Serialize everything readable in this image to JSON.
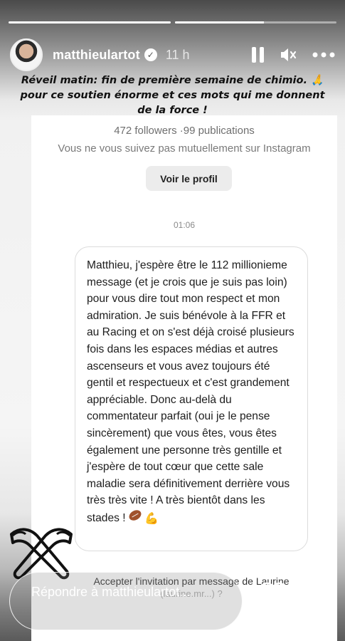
{
  "story": {
    "progress": [
      1.0,
      0.55
    ],
    "username": "matthieulartot",
    "time_ago": "11 h",
    "caption": "Réveil matin: fin de première semaine de chimio. 🙏 pour ce soutien énorme  et ces mots qui me donnent de la force !"
  },
  "dm": {
    "stats": "472 followers ·99 publications",
    "mutual": "Vous ne vous suivez pas mutuellement sur Instagram",
    "profile_button": "Voir le profil",
    "timestamp": "01:06",
    "message": "Matthieu, j'espère être le 112 millionieme message (et je crois que je suis pas loin) pour vous dire tout mon respect et mon admiration. Je suis bénévole à la FFR et au Racing et on s'est déjà croisé plusieurs fois dans les espaces médias et autres ascenseurs et vous avez toujours été gentil et respectueux et c'est grandement appréciable. Donc au-delà du commentateur parfait (oui je le pense sincèrement) que vous êtes, vous êtes également une personne très gentille et j'espère de tout cœur que cette sale maladie sera définitivement derrière vous très très vite ! A très bientôt dans les stades !",
    "accept_invite": "Accepter l'invitation par message de Laurine",
    "accept_sub": "(laurine.mr...) ?"
  },
  "reply": {
    "placeholder": "Répondre à matthieulartot..."
  },
  "colors": {
    "verified": "#ffffff",
    "bubble_border": "#dcdcdc"
  },
  "icons": [
    "verified-icon",
    "pause-icon",
    "mute-icon",
    "more-icon",
    "heart-icon",
    "send-icon",
    "rugby-ball-icon",
    "muscle-icon"
  ]
}
